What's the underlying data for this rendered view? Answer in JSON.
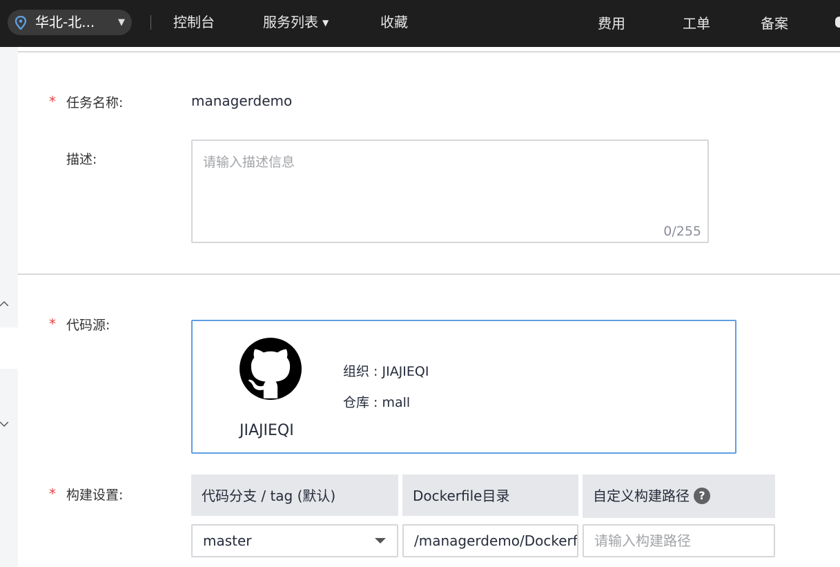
{
  "topbar": {
    "region": "华北-北...",
    "nav": [
      "控制台",
      "服务列表",
      "收藏"
    ],
    "nav_right": [
      "费用",
      "工单",
      "备案"
    ]
  },
  "form": {
    "task_name_label": "任务名称:",
    "task_name_value": "managerdemo",
    "desc_label": "描述:",
    "desc_placeholder": "请输入描述信息",
    "desc_count": "0/255",
    "source_label": "代码源:",
    "source": {
      "account": "JIAJIEQI",
      "org_line": "组织 : JIAJIEQI",
      "repo_line": "仓库 : mall"
    },
    "build_label": "构建设置:",
    "build": {
      "col_branch": "代码分支 / tag (默认)",
      "col_dockerfile": "Dockerfile目录",
      "col_custom": "自定义构建路径",
      "help_glyph": "?",
      "branch_value": "master",
      "dockerfile_value": "/managerdemo/Dockerfile",
      "custom_placeholder": "请输入构建路径"
    }
  },
  "colors": {
    "accent": "#5e9ee0",
    "required": "#e64545",
    "topbar": "#1e1e1e"
  }
}
